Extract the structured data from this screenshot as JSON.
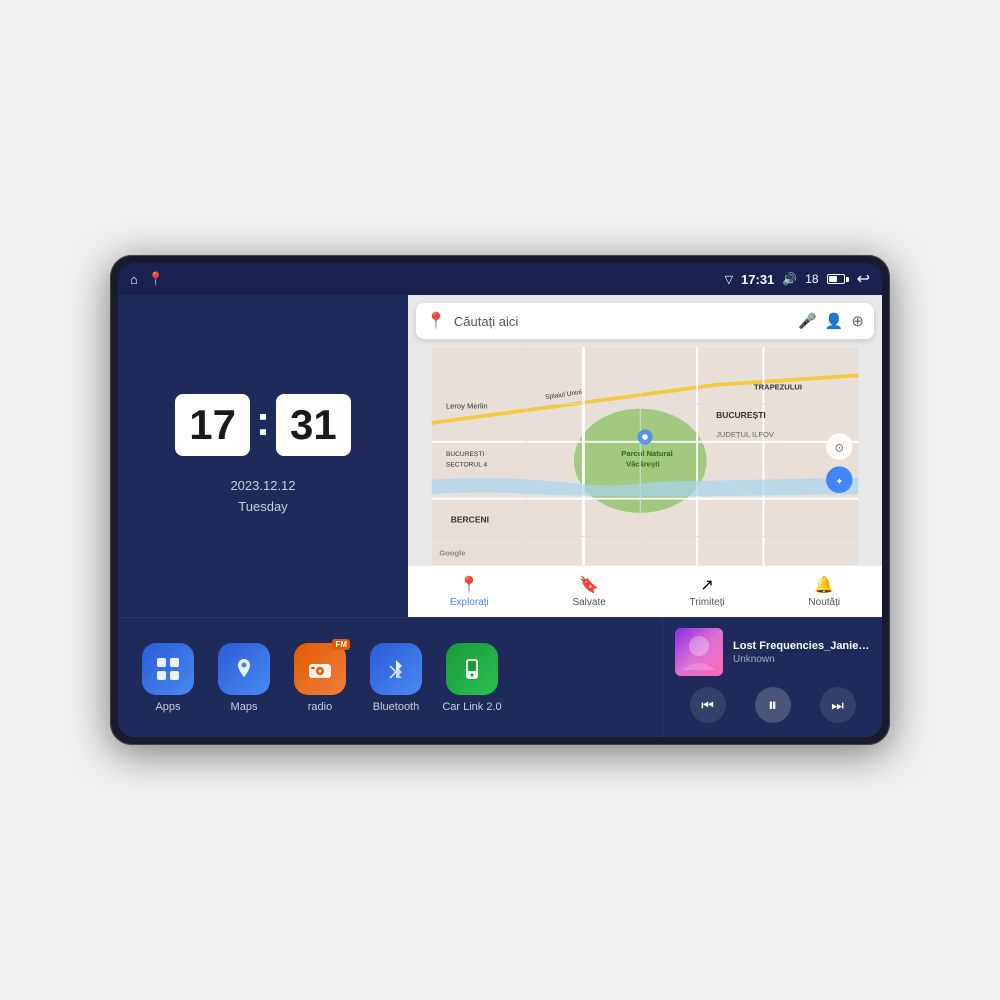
{
  "device": {
    "screen": {
      "status_bar": {
        "left_icons": [
          "home",
          "maps-pin"
        ],
        "time": "17:31",
        "signal_icon": "signal",
        "volume_icon": "volume",
        "volume_level": "18",
        "battery_icon": "battery",
        "back_icon": "back"
      },
      "clock": {
        "hours": "17",
        "minutes": "31",
        "date": "2023.12.12",
        "day": "Tuesday"
      },
      "map": {
        "search_placeholder": "Căutați aici",
        "bottom_nav": [
          {
            "label": "Explorați",
            "icon": "📍",
            "active": true
          },
          {
            "label": "Salvate",
            "icon": "🔖",
            "active": false
          },
          {
            "label": "Trimiteți",
            "icon": "🔄",
            "active": false
          },
          {
            "label": "Noutăți",
            "icon": "🔔",
            "active": false
          }
        ],
        "map_labels": [
          "TRAPEZULUI",
          "BUCUREȘTI",
          "JUDEȚUL ILFOV",
          "BERCENI",
          "Parcul Natural Văcărești",
          "Leroy Merlin",
          "BUCUREȘTI SECTORUL 4",
          "Splaiul Unirii"
        ]
      },
      "apps": [
        {
          "id": "apps",
          "label": "Apps",
          "icon_type": "grid",
          "color": "blue"
        },
        {
          "id": "maps",
          "label": "Maps",
          "icon_type": "map-pin",
          "color": "blue"
        },
        {
          "id": "radio",
          "label": "radio",
          "icon_type": "radio",
          "color": "orange"
        },
        {
          "id": "bluetooth",
          "label": "Bluetooth",
          "icon_type": "bluetooth",
          "color": "blue"
        },
        {
          "id": "carlink",
          "label": "Car Link 2.0",
          "icon_type": "phone",
          "color": "green"
        }
      ],
      "music": {
        "title": "Lost Frequencies_Janieck Devy-...",
        "artist": "Unknown",
        "controls": [
          "prev",
          "play-pause",
          "next"
        ]
      }
    }
  }
}
